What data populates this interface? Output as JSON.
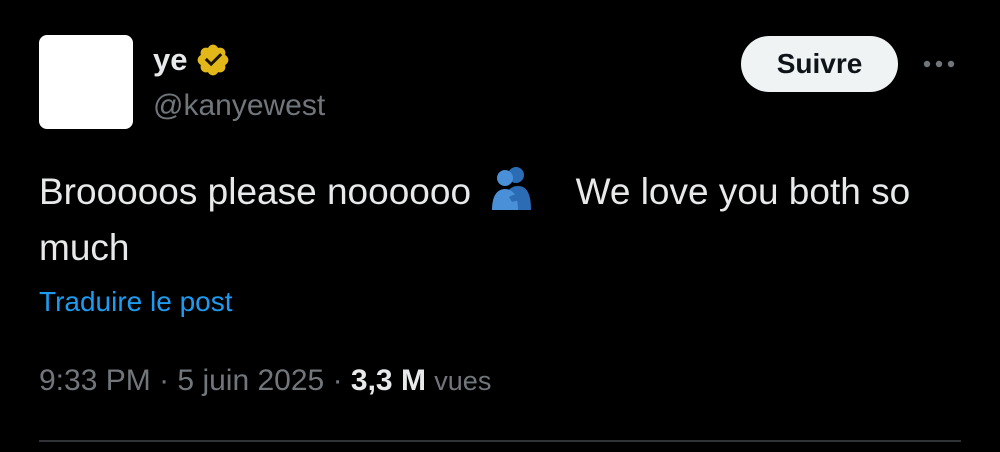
{
  "author": {
    "display_name": "ye",
    "handle": "@kanyewest",
    "verified_badge_color": "#e2b719"
  },
  "actions": {
    "follow_label": "Suivre",
    "more_icon": "more-horizontal-icon"
  },
  "post": {
    "text_part1": "Brooooos please noooooo",
    "emoji": "people-hugging-emoji",
    "text_part2": "We love you both so much",
    "translate_label": "Traduire le post"
  },
  "meta": {
    "time": "9:33 PM",
    "separator": "·",
    "date": "5 juin 2025",
    "views_count": "3,3 M",
    "views_label": "vues"
  },
  "colors": {
    "background": "#000000",
    "primary_text": "#e7e9ea",
    "secondary_text": "#71767b",
    "link": "#1d9bf0",
    "follow_bg": "#eff3f4"
  }
}
